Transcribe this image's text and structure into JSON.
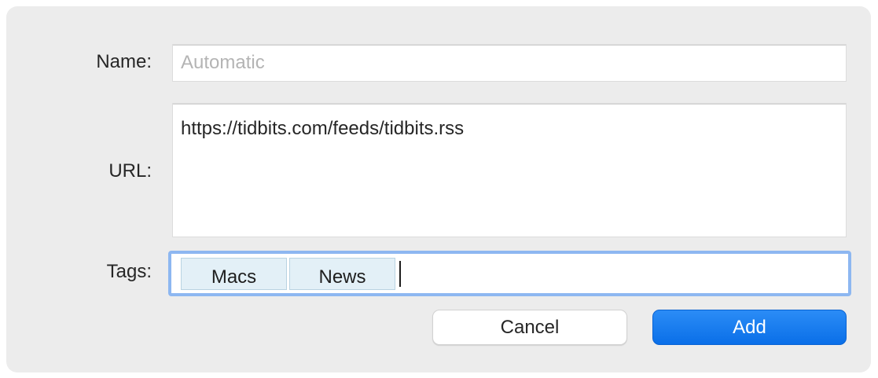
{
  "form": {
    "name_label": "Name:",
    "name_value": "",
    "name_placeholder": "Automatic",
    "url_label": "URL:",
    "url_value": "https://tidbits.com/feeds/tidbits.rss",
    "tags_label": "Tags:",
    "tags": [
      "Macs",
      "News"
    ]
  },
  "buttons": {
    "cancel_label": "Cancel",
    "add_label": "Add"
  },
  "colors": {
    "dialog_background": "#ececec",
    "focus_ring": "#8db7f1",
    "tag_background": "#e3f0f7",
    "primary_button": "#0a6fe8",
    "placeholder_text": "#b4b4b4"
  }
}
